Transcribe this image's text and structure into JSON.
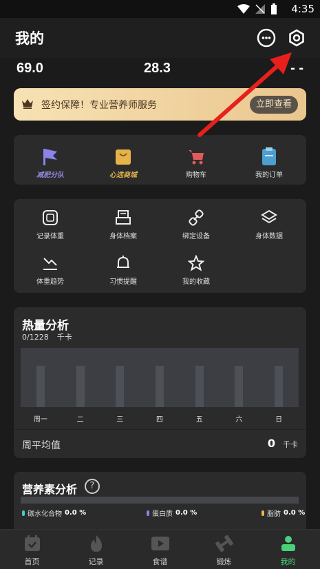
{
  "status": {
    "time": "4:35"
  },
  "header": {
    "title": "我的"
  },
  "stats": {
    "weight": "69.0",
    "bmi": "28.3",
    "third": "- -"
  },
  "banner": {
    "text": "签约保障！专业营养师服务",
    "button": "立即查看"
  },
  "shop": [
    {
      "label": "减肥分队",
      "icon": "flag-icon"
    },
    {
      "label": "心选商城",
      "icon": "bag-icon"
    },
    {
      "label": "购物车",
      "icon": "cart-icon"
    },
    {
      "label": "我的订单",
      "icon": "clipboard-icon"
    }
  ],
  "tools": [
    {
      "label": "记录体重",
      "icon": "scale-icon"
    },
    {
      "label": "身体档案",
      "icon": "printer-icon"
    },
    {
      "label": "绑定设备",
      "icon": "link-icon"
    },
    {
      "label": "身体数据",
      "icon": "layers-icon"
    },
    {
      "label": "体重趋势",
      "icon": "trend-down-icon"
    },
    {
      "label": "习惯提醒",
      "icon": "bell-icon"
    },
    {
      "label": "我的收藏",
      "icon": "star-icon"
    }
  ],
  "heat": {
    "title": "热量分析",
    "value": "0/1228",
    "unit": "千卡",
    "days": [
      "周一",
      "二",
      "三",
      "四",
      "五",
      "六",
      "日"
    ],
    "avg_label": "周平均值",
    "avg_value": "0",
    "avg_unit": "千卡"
  },
  "nutrition": {
    "title": "营养素分析",
    "help": "?",
    "items": [
      {
        "label": "碳水化合物",
        "value": "0.0 %",
        "color": "#3fd0c6"
      },
      {
        "label": "蛋白质",
        "value": "0.0 %",
        "color": "#8a84e8"
      },
      {
        "label": "脂肪",
        "value": "0.0 %",
        "color": "#f0b64a"
      }
    ]
  },
  "tabs": [
    {
      "label": "首页",
      "icon": "calendar-icon"
    },
    {
      "label": "记录",
      "icon": "flame-icon"
    },
    {
      "label": "食谱",
      "icon": "recipe-icon"
    },
    {
      "label": "锻炼",
      "icon": "dumbbell-icon"
    },
    {
      "label": "我的",
      "icon": "profile-icon"
    }
  ],
  "colors": {
    "accent": "#4ad07a",
    "arrow": "#e8201c",
    "banner": "#eac68e"
  }
}
